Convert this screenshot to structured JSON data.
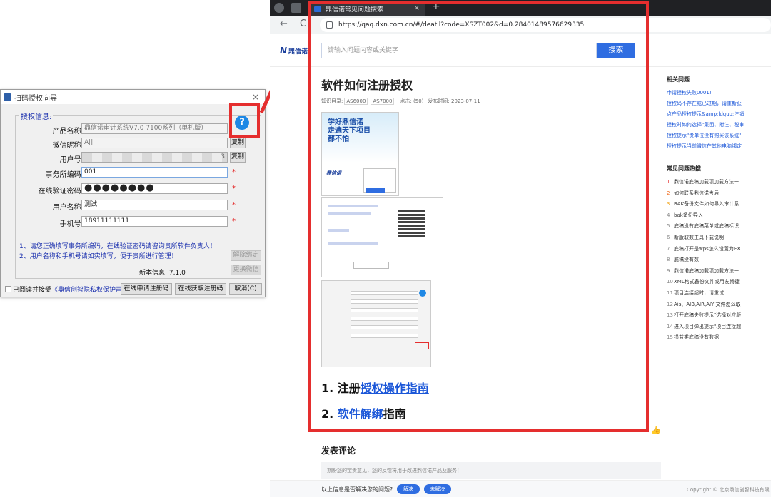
{
  "dialog": {
    "title": "扫码授权向导",
    "close": "×",
    "group_label": "授权信息:",
    "fields": [
      {
        "label": "产品名称:",
        "value": "鼎信诺审计系统V7.0 7100系列（单机版）"
      },
      {
        "label": "微信昵称:",
        "value": "A||"
      },
      {
        "label": "用户号:",
        "value": "3"
      },
      {
        "label": "事务所编码:",
        "value": "001"
      },
      {
        "label": "在线验证密码:",
        "value": "●●●●●●●●"
      },
      {
        "label": "用户名称:",
        "value": "测试"
      },
      {
        "label": "手机号:",
        "value": "18911111111"
      }
    ],
    "required_mark": "*",
    "copy_button": "复制",
    "help_icon": "?",
    "notes": [
      "1、请您正确填写事务所编码，在线验证密码请咨询贵所软件负责人！",
      "2、用户名称和手机号请如实填写，便于贵所进行管理！"
    ],
    "unbind_button": "解除绑定",
    "change_wechat_button": "更换微信",
    "version_label": "新本信息: 7.1.0",
    "agree_prefix": "已阅读并接受",
    "agree_link": "《鼎信创智隐私权保护声明》",
    "online_apply_button": "在线申请注册码",
    "online_get_button": "在线获取注册码",
    "cancel_button": "取消(C)"
  },
  "browser": {
    "tab_title": "鼎信诺常见问题搜索",
    "tab_close": "×",
    "new_tab": "+",
    "url": "https://qaq.dxn.com.cn/#/deatil?code=XSZT002&d=0.28401489576629335",
    "nav_back": "←",
    "nav_reload": "C"
  },
  "site": {
    "logo": "N",
    "logo_sub": "鼎信诺",
    "search_placeholder": "请输入问题内容或关键字",
    "search_button": "搜索"
  },
  "article": {
    "title": "软件如何注册授权",
    "meta_category": "知识目录:",
    "meta_tags": [
      "AS6000",
      "AS7000"
    ],
    "meta_views": "点击: (50)",
    "meta_date": "发布时间: 2023-07-11",
    "shot1_text": "学好鼎信诺\n走遍天下项目\n都不怕",
    "shot1_logo": "鼎信诺",
    "guide1_num": "1. 注册",
    "guide1_link": "授权操作指南",
    "guide2_num": "2. ",
    "guide2_link": "软件解绑",
    "guide2_tail": "指南",
    "thumb": "👍"
  },
  "comments": {
    "heading": "发表评论",
    "placeholder": "期盼您的宝贵意见，您的反馈将用于改进鼎信诺产品及服务！"
  },
  "footer": {
    "question": "以上信息是否解决您的问题?",
    "yes": "解决",
    "no": "未解决",
    "copyright": "Copyright © 北京鼎信创智科技有限"
  },
  "side": {
    "related_heading": "相关问题",
    "related": [
      "申请授权失败0001!",
      "授权码不存在或已过期，请重新获",
      "点产品授权提示&amp;ldquo;注销",
      "授权时如何选择\"集团、附注、税审",
      "授权提示\"贵单位没有购买该系统\"",
      "授权提示当前微信在其他电脑绑定"
    ],
    "hot_heading": "常见问题热搜",
    "hot": [
      {
        "n": "1",
        "t": "鼎信诺底稿加载项加载方法一"
      },
      {
        "n": "2",
        "t": "如何联系鼎信诺售后"
      },
      {
        "n": "3",
        "t": "BAK备份文件如何导入审计系"
      },
      {
        "n": "4",
        "t": "bak备份导入"
      },
      {
        "n": "5",
        "t": "底稿没有底稿菜单或底稿标识"
      },
      {
        "n": "6",
        "t": "新版取数工具下载说明"
      },
      {
        "n": "7",
        "t": "底稿打开是wps怎么设置为EX"
      },
      {
        "n": "8",
        "t": "底稿没有数"
      },
      {
        "n": "9",
        "t": "鼎信诺底稿加载项加载方法一"
      },
      {
        "n": "10",
        "t": "XML格式备份文件或用友畅捷"
      },
      {
        "n": "11",
        "t": "项目连接超时，请重试"
      },
      {
        "n": "12",
        "t": "Ais、AIB,AIR,AIY 文件怎么取"
      },
      {
        "n": "13",
        "t": "打开底稿失败提示\"选择对应版"
      },
      {
        "n": "14",
        "t": "进入项目弹出提示\"项目连接超"
      },
      {
        "n": "15",
        "t": "损益类底稿没有数据"
      }
    ]
  },
  "colors": {
    "accent": "#2f6de1",
    "highlight_red": "#e52e2e",
    "link": "#1a56d8"
  }
}
